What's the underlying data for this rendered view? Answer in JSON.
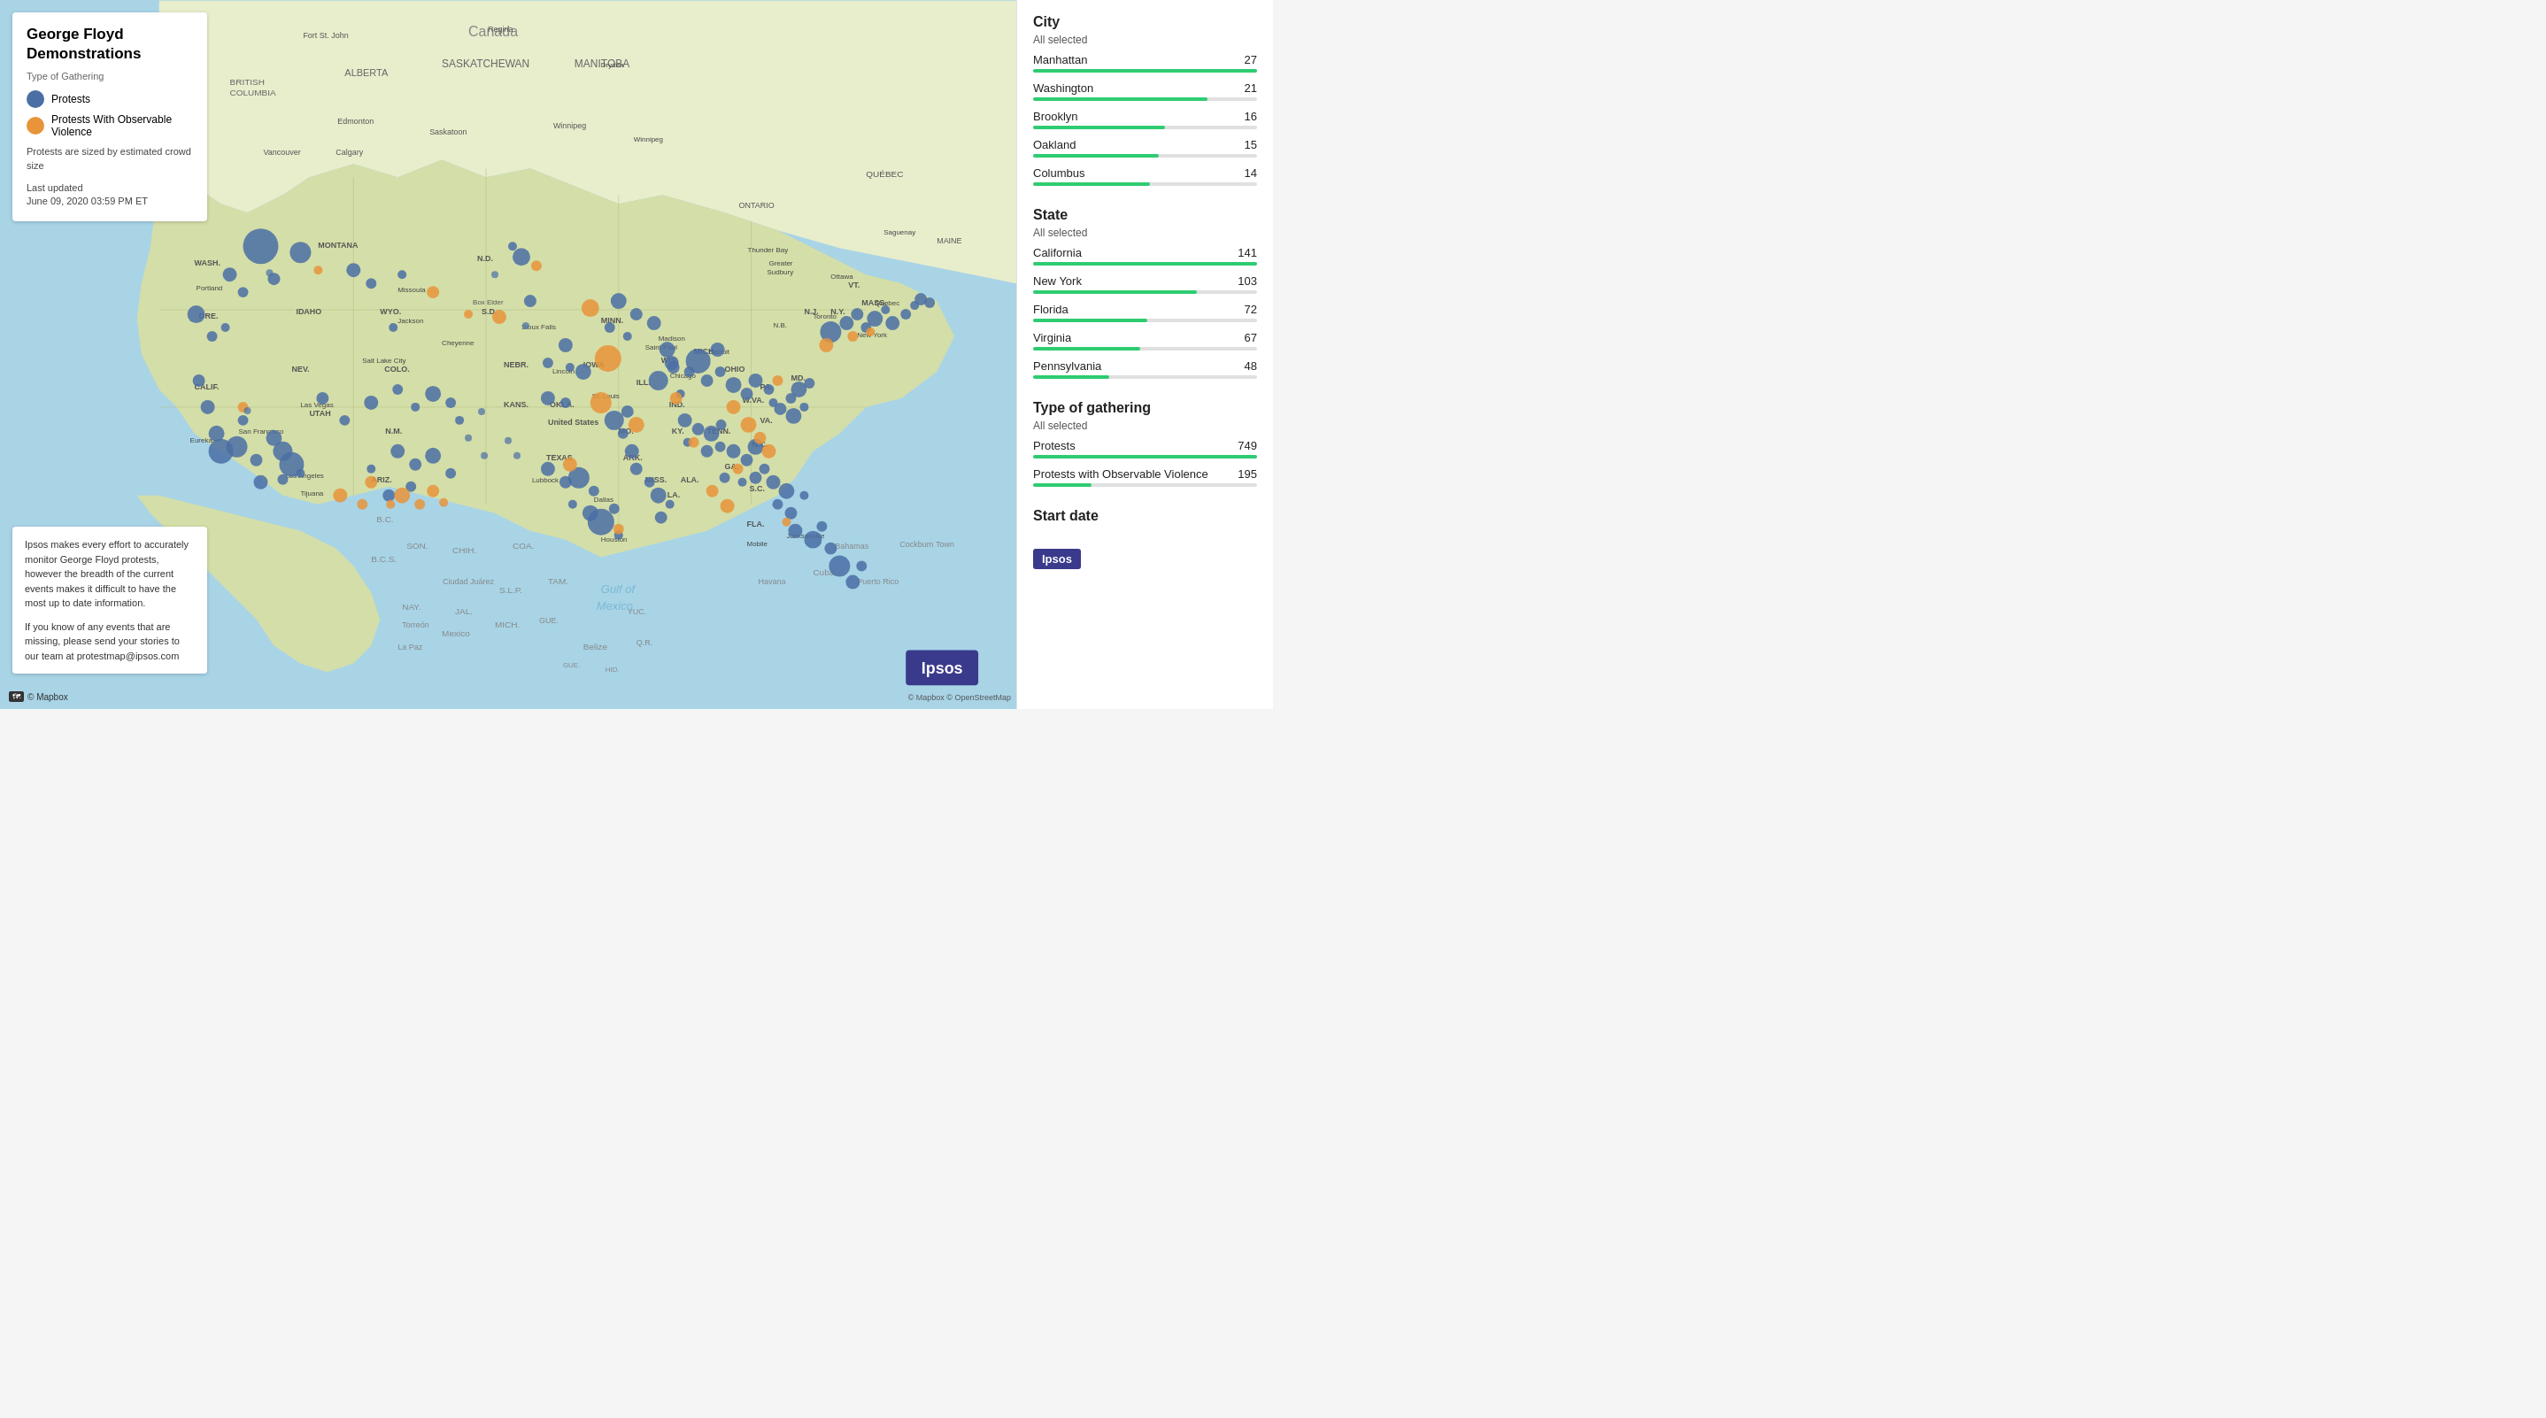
{
  "legend": {
    "title": "George Floyd Demonstrations",
    "type_label": "Type of Gathering",
    "items": [
      {
        "label": "Protests",
        "color": "blue"
      },
      {
        "label": "Protests With Observable Violence",
        "color": "orange"
      }
    ],
    "size_note": "Protests are sized by estimated crowd size",
    "updated_label": "Last updated",
    "updated_date": "June 09, 2020 03:59 PM ET"
  },
  "info_box": {
    "para1": "Ipsos makes every effort to accurately monitor George Floyd protests, however the breadth of the current events makes it difficult to have the most up to date information.",
    "para2": "If you know of any events that are missing, please send your stories to our team at protestmap@ipsos.com"
  },
  "credits": {
    "mapbox": "© Mapbox",
    "openstreet": "© Mapbox © OpenStreetMap"
  },
  "sidebar": {
    "city_section": {
      "title": "City",
      "all_selected": "All selected",
      "items": [
        {
          "label": "Manhattan",
          "value": 27,
          "max": 27
        },
        {
          "label": "Washington",
          "value": 21,
          "max": 27
        },
        {
          "label": "Brooklyn",
          "value": 16,
          "max": 27
        },
        {
          "label": "Oakland",
          "value": 15,
          "max": 27
        },
        {
          "label": "Columbus",
          "value": 14,
          "max": 27
        }
      ]
    },
    "state_section": {
      "title": "State",
      "all_selected": "All selected",
      "items": [
        {
          "label": "California",
          "value": 141,
          "max": 141
        },
        {
          "label": "New York",
          "value": 103,
          "max": 141
        },
        {
          "label": "Florida",
          "value": 72,
          "max": 141
        },
        {
          "label": "Virginia",
          "value": 67,
          "max": 141
        },
        {
          "label": "Pennsylvania",
          "value": 48,
          "max": 141
        }
      ]
    },
    "type_section": {
      "title": "Type of gathering",
      "all_selected": "All selected",
      "items": [
        {
          "label": "Protests",
          "value": 749,
          "max": 749
        },
        {
          "label": "Protests with Observable Violence",
          "value": 195,
          "max": 749
        }
      ]
    },
    "start_date": {
      "title": "Start date"
    },
    "ipsos_label": "Ipsos"
  }
}
